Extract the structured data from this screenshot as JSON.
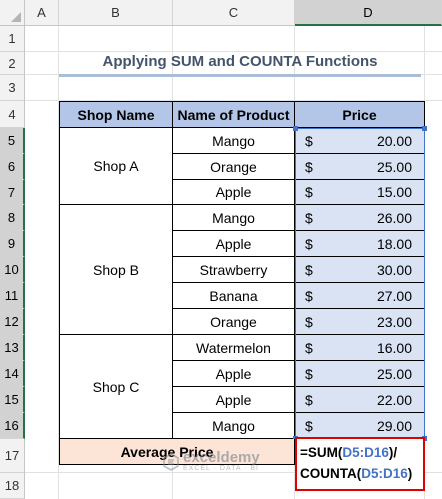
{
  "columns": [
    "A",
    "B",
    "C",
    "D"
  ],
  "rows": [
    "1",
    "2",
    "3",
    "4",
    "5",
    "6",
    "7",
    "8",
    "9",
    "10",
    "11",
    "12",
    "13",
    "14",
    "15",
    "16",
    "17",
    "18"
  ],
  "title": "Applying SUM and COUNTA Functions",
  "table": {
    "headers": [
      "Shop Name",
      "Name of Product",
      "Price"
    ],
    "shops": [
      "Shop A",
      "Shop B",
      "Shop C"
    ],
    "rows": [
      {
        "product": "Mango",
        "currency": "$",
        "price": "20.00"
      },
      {
        "product": "Orange",
        "currency": "$",
        "price": "25.00"
      },
      {
        "product": "Apple",
        "currency": "$",
        "price": "15.00"
      },
      {
        "product": "Mango",
        "currency": "$",
        "price": "26.00"
      },
      {
        "product": "Apple",
        "currency": "$",
        "price": "18.00"
      },
      {
        "product": "Strawberry",
        "currency": "$",
        "price": "30.00"
      },
      {
        "product": "Banana",
        "currency": "$",
        "price": "27.00"
      },
      {
        "product": "Orange",
        "currency": "$",
        "price": "23.00"
      },
      {
        "product": "Watermelon",
        "currency": "$",
        "price": "16.00"
      },
      {
        "product": "Apple",
        "currency": "$",
        "price": "25.00"
      },
      {
        "product": "Apple",
        "currency": "$",
        "price": "22.00"
      },
      {
        "product": "Mango",
        "currency": "$",
        "price": "29.00"
      }
    ],
    "average_label": "Average Price"
  },
  "formula": {
    "line1_prefix": "=SUM(",
    "line1_ref": "D5:D16",
    "line1_suffix": ")/",
    "line2_prefix": "COUNTA(",
    "line2_ref": "D5:D16",
    "line2_suffix": ")"
  },
  "watermark": {
    "name": "exceldemy",
    "tagline": "EXCEL · DATA · BI"
  },
  "colors": {
    "header_fill": "#b4c6e7",
    "price_fill": "#dae3f3",
    "average_fill": "#fce4d6",
    "formula_border": "#e00000",
    "ref_color": "#4472c4",
    "title_color": "#44546a"
  }
}
